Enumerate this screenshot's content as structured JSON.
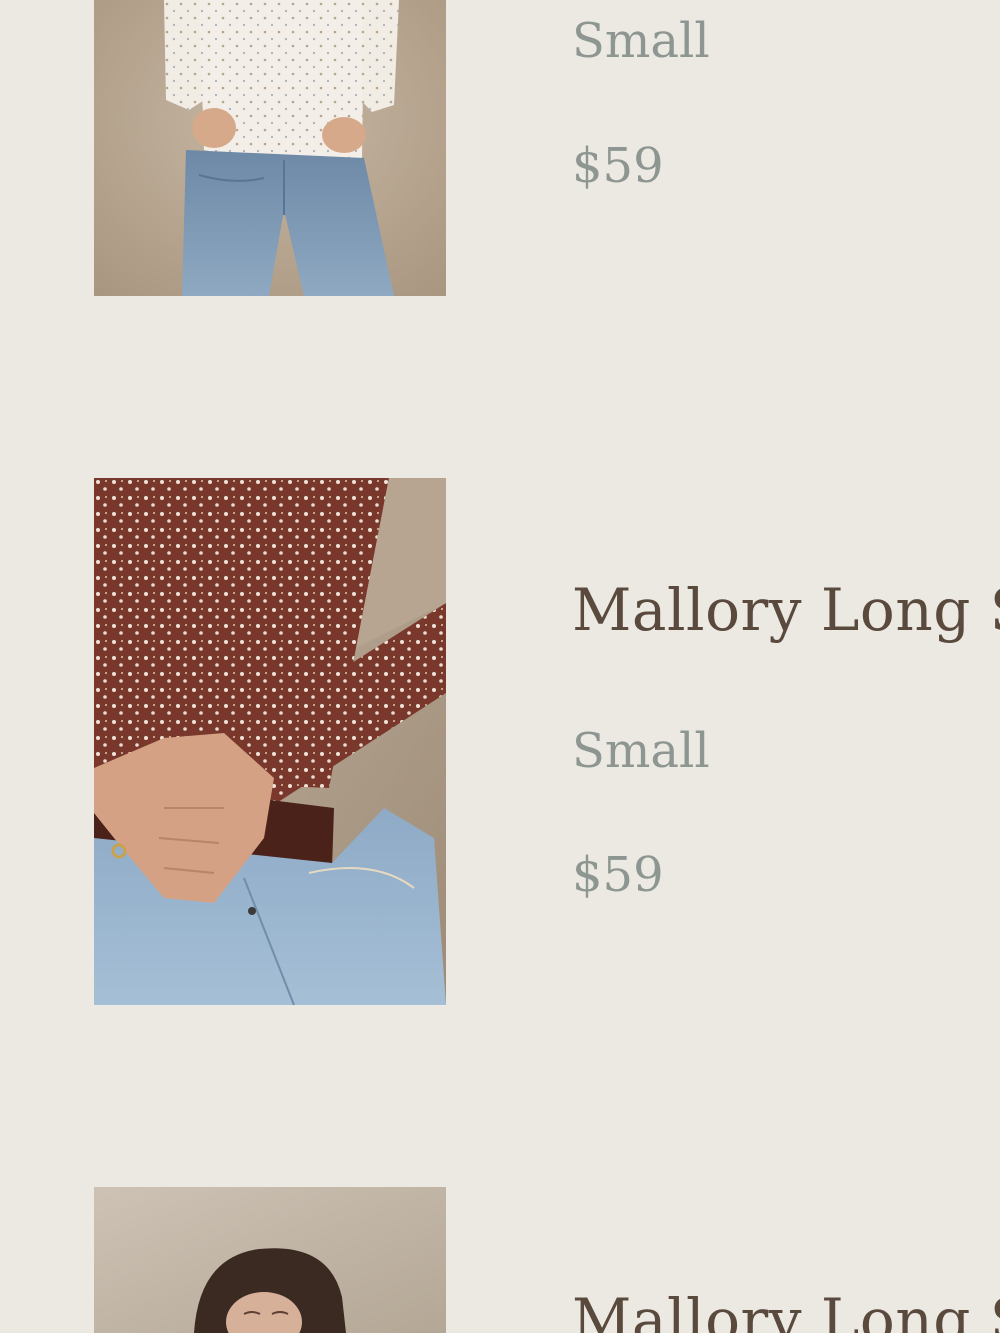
{
  "products": [
    {
      "name": "",
      "size": "Small",
      "price": "$59",
      "image": "model-cream-floral-top-jeans"
    },
    {
      "name": "Mallory Long S",
      "size": "Small",
      "price": "$59",
      "image": "model-brown-floral-top-jeans"
    },
    {
      "name": "Mallory Long S",
      "size": "",
      "price": "",
      "image": "model-dark-hair-portrait"
    }
  ],
  "colors": {
    "background": "#ece9e3",
    "name_text": "#5a4a3e",
    "meta_text": "#8e9692"
  }
}
